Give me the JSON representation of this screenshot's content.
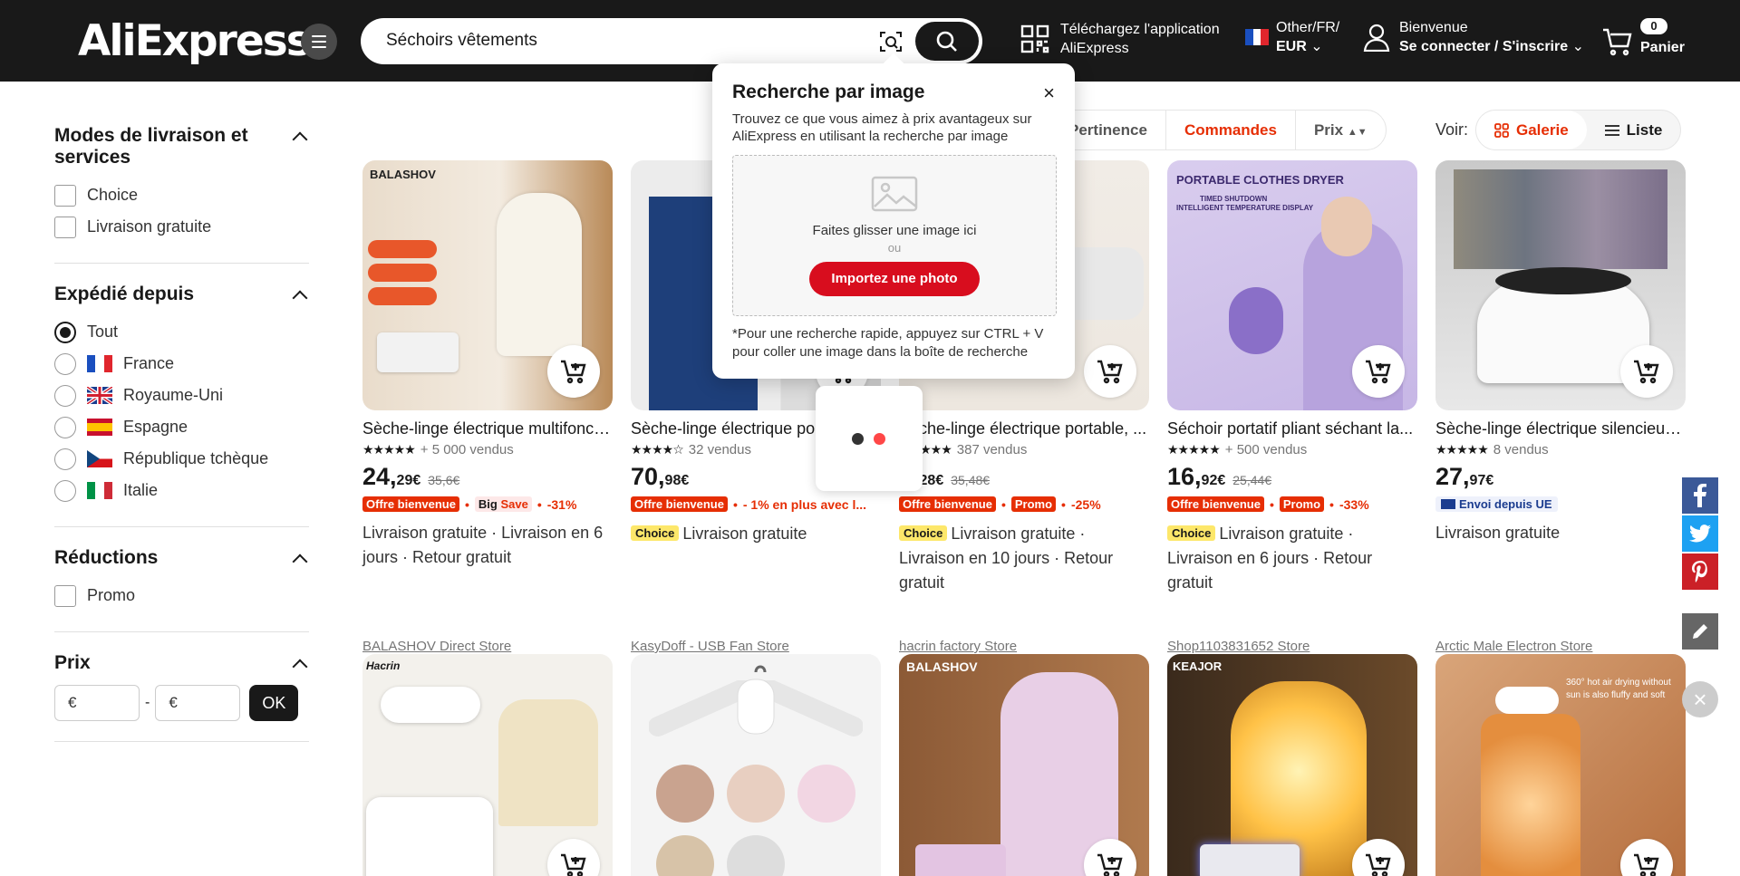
{
  "header": {
    "logo": "AliExpress",
    "search_value": "Séchoirs vêtements",
    "app_line1": "Téléchargez l'application",
    "app_line2": "AliExpress",
    "region_line1": "Other/FR/",
    "region_line2": "EUR",
    "account_line1": "Bienvenue",
    "account_line2": "Se connecter / S'inscrire",
    "cart_count": "0",
    "cart_label": "Panier"
  },
  "sidebar": {
    "delivery_title": "Modes de livraison et services",
    "delivery_options": [
      "Choice",
      "Livraison gratuite"
    ],
    "ship_from_title": "Expédié depuis",
    "ship_from_options": [
      "Tout",
      "France",
      "Royaume-Uni",
      "Espagne",
      "République tchèque",
      "Italie"
    ],
    "discount_title": "Réductions",
    "discount_options": [
      "Promo"
    ],
    "price_title": "Prix",
    "price_min_placeholder": "€",
    "price_max_placeholder": "€",
    "price_sep": "-",
    "ok_label": "OK"
  },
  "sort": {
    "options": [
      "Pertinence",
      "Commandes",
      "Prix"
    ],
    "active": "Commandes",
    "view_label": "Voir:",
    "view_gallery": "Galerie",
    "view_list": "Liste"
  },
  "popup": {
    "title": "Recherche par image",
    "close": "×",
    "description": "Trouvez ce que vous aimez à prix avantageux sur AliExpress en utilisant la recherche par image",
    "drop_text": "Faites glisser une image ici",
    "or": "ou",
    "upload_button": "Importez une photo",
    "note": "*Pour une recherche rapide, appuyez sur CTRL + V pour coller une image dans la boîte de recherche"
  },
  "products": [
    {
      "title": "Sèche-linge électrique multifonctionnel portable",
      "sold": "+ 5 000 vendus",
      "price_int": "24,",
      "price_dec": "29€",
      "old_price": "35,6€",
      "badge1": "Offre bienvenue",
      "badge2_a": "Big",
      "badge2_b": "Save",
      "discount": "-31%",
      "shipping": "Livraison gratuite · Livraison en 6 jours · Retour gratuit",
      "store": "BALASHOV Direct Store",
      "brand": "BALASHOV"
    },
    {
      "title": "Sèche-linge électrique portable",
      "sold": "32 vendus",
      "price_int": "70,",
      "price_dec": "98€",
      "badge1": "Offre bienvenue",
      "extra": "- 1% en plus avec l...",
      "choice": "Choice",
      "shipping": "Livraison gratuite",
      "store": "KasyDoff - USB Fan Store"
    },
    {
      "title": "Sèche-linge électrique portable, ...",
      "sold": "387 vendus",
      "price_int": "5,",
      "price_dec": "28€",
      "old_price": "35,48€",
      "badge1": "Offre bienvenue",
      "badge2": "Promo",
      "discount": "-25%",
      "choice": "Choice",
      "shipping": "Livraison gratuite · Livraison en 10 jours · Retour gratuit",
      "store": "hacrin factory Store"
    },
    {
      "title": "Séchoir portatif pliant séchant la...",
      "sold": "+ 500 vendus",
      "price_int": "16,",
      "price_dec": "92€",
      "old_price": "25,44€",
      "badge1": "Offre bienvenue",
      "badge2": "Promo",
      "discount": "-33%",
      "choice": "Choice",
      "shipping": "Livraison gratuite · Livraison en 6 jours · Retour gratuit",
      "store": "Shop1103831652 Store",
      "img_title": "PORTABLE CLOTHES DRYER",
      "img_sub1": "TIMED SHUTDOWN",
      "img_sub2": "INTELLIGENT TEMPERATURE DISPLAY"
    },
    {
      "title": "Sèche-linge électrique silencieux...",
      "sold": "8 vendus",
      "price_int": "27,",
      "price_dec": "97€",
      "eu_badge": "Envoi depuis UE",
      "shipping": "Livraison gratuite",
      "store": "Arctic Male Electron Store"
    }
  ],
  "row2": {
    "brand1": "Hacrin",
    "brand3": "BALASHOV",
    "brand4": "KEAJOR",
    "img5_line1": "360° hot air drying without",
    "img5_line2": "sun is also fluffy and soft"
  },
  "colors": {
    "accent": "#e62e04",
    "header_bg": "#191919",
    "choice": "#fde76a",
    "upload_btn": "#d80d1e"
  }
}
